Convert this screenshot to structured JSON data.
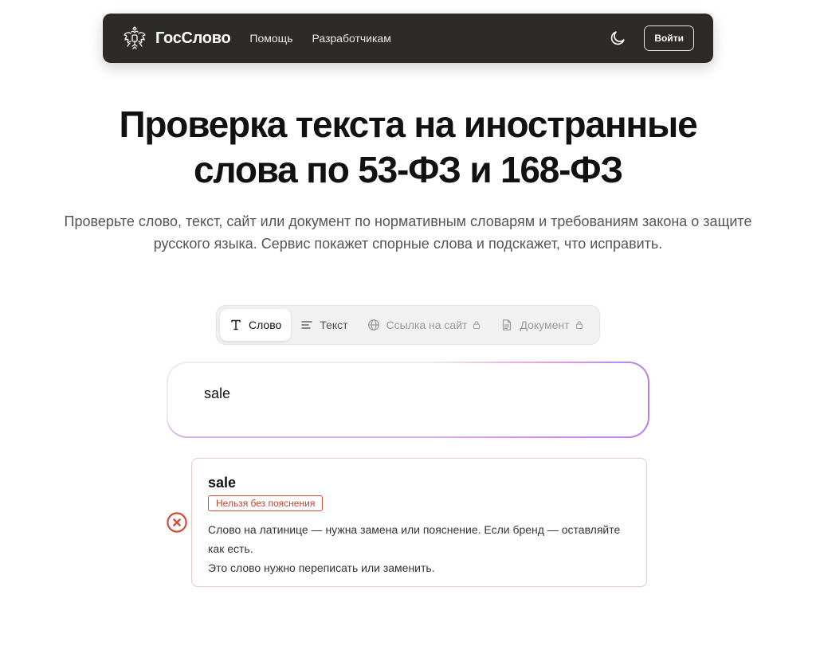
{
  "header": {
    "brand": "ГосСлово",
    "nav": [
      {
        "label": "Помощь"
      },
      {
        "label": "Разработчикам"
      }
    ],
    "login_label": "Войти"
  },
  "hero": {
    "title": "Проверка текста на иностранные слова по 53-ФЗ и 168-ФЗ",
    "subtitle": "Проверьте слово, текст, сайт или документ по нормативным словарям и требованиям закона о защите русского языка. Сервис покажет спорные слова и подскажет, что исправить."
  },
  "tabs": [
    {
      "label": "Слово",
      "icon": "text-type-icon",
      "active": true,
      "locked": false
    },
    {
      "label": "Текст",
      "icon": "align-left-icon",
      "active": false,
      "locked": false
    },
    {
      "label": "Ссылка на сайт",
      "icon": "globe-icon",
      "active": false,
      "locked": true
    },
    {
      "label": "Документ",
      "icon": "file-text-icon",
      "active": false,
      "locked": true
    }
  ],
  "input": {
    "value": "sale"
  },
  "result": {
    "word": "sale",
    "badge": "Нельзя без пояснения",
    "description": "Слово на латинице — нужна замена или пояснение. Если бренд — оставляйте как есть.",
    "advice": "Это слово нужно переписать или заменить.",
    "status": "error"
  },
  "colors": {
    "navbar_bg": "#2d2b2a",
    "error": "#d64a3a",
    "card_border": "#f1c9c4",
    "input_gradient_pink": "#f1a6dc",
    "input_gradient_purple": "#b27ff0"
  }
}
